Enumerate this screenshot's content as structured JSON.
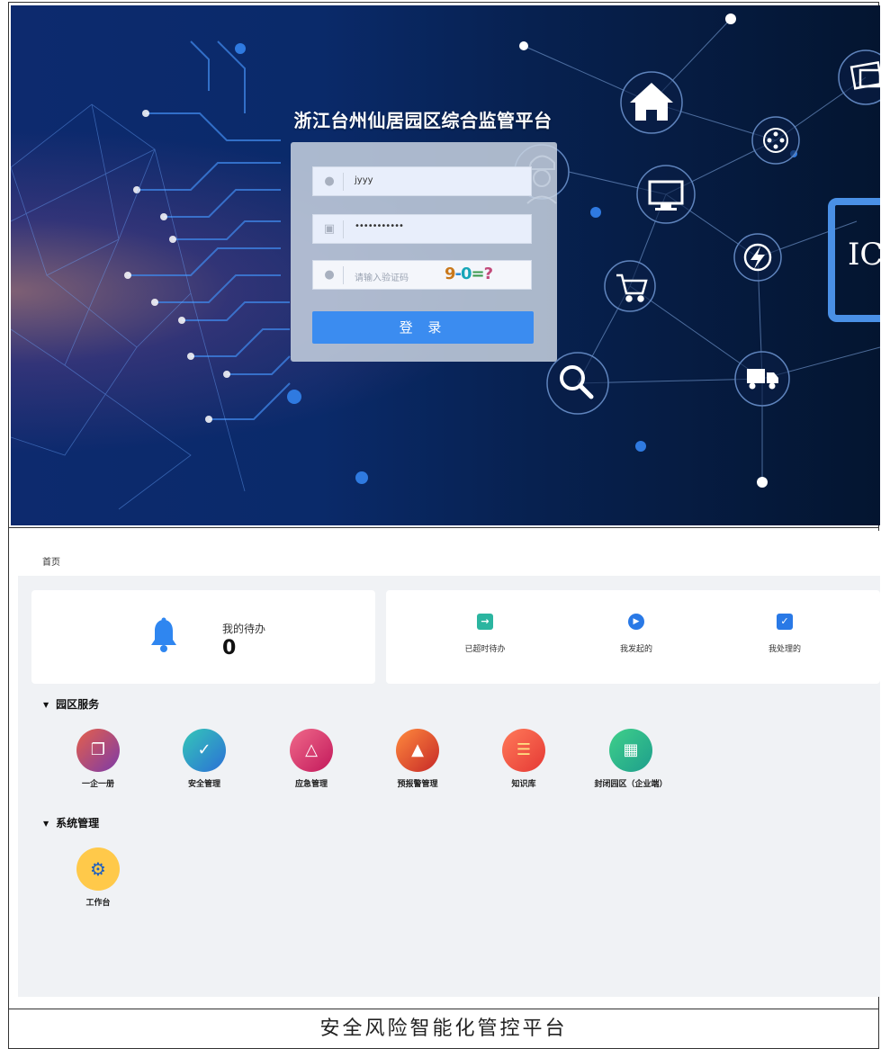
{
  "login": {
    "title": "浙江台州仙居园区综合监管平台",
    "username_value": "jyyy",
    "password_value": "•••••••••••",
    "captcha_placeholder": "请输入验证码",
    "captcha_image_text": "9-0=?",
    "login_button_label": "登 录",
    "colors": {
      "button": "#3b8cf0",
      "background": "#0a2a6a"
    },
    "network_icons": [
      "home-icon",
      "image-icon",
      "film-reel-icon",
      "monitor-icon",
      "lightning-icon",
      "shopping-cart-icon",
      "magnifier-icon",
      "truck-icon",
      "ic-chip-icon",
      "worker-icon"
    ]
  },
  "home": {
    "breadcrumb": "首页",
    "todo": {
      "label": "我的待办",
      "count": "0"
    },
    "stats": [
      {
        "label": "已超时待办",
        "icon": "exit-icon",
        "color": "#2bb5a0"
      },
      {
        "label": "我发起的",
        "icon": "play-icon",
        "color": "#2979e6"
      },
      {
        "label": "我处理的",
        "icon": "check-calendar-icon",
        "color": "#2979e6"
      }
    ],
    "sections": [
      {
        "title": "园区服务",
        "apps": [
          {
            "label": "一企一册",
            "icon": "copy-icon"
          },
          {
            "label": "安全管理",
            "icon": "shield-check-icon"
          },
          {
            "label": "应急管理",
            "icon": "document-alert-icon"
          },
          {
            "label": "预报警管理",
            "icon": "alarm-light-icon"
          },
          {
            "label": "知识库",
            "icon": "chat-card-icon"
          },
          {
            "label": "封闭园区（企业端）",
            "icon": "enclosure-icon"
          }
        ]
      },
      {
        "title": "系统管理",
        "apps": [
          {
            "label": "工作台",
            "icon": "gear-window-icon"
          }
        ]
      }
    ]
  },
  "caption": "安全风险智能化管控平台"
}
